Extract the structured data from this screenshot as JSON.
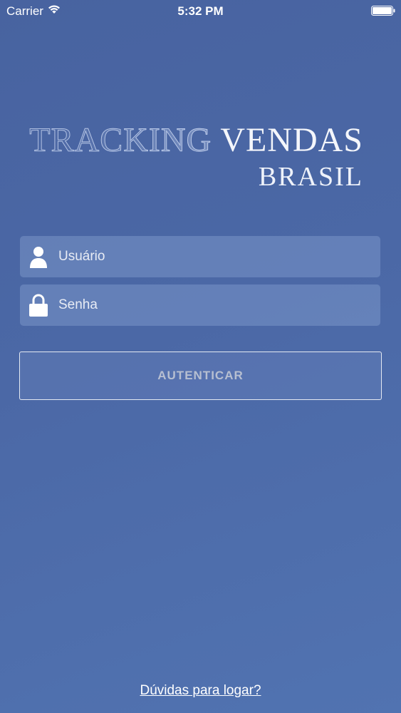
{
  "status_bar": {
    "carrier": "Carrier",
    "time": "5:32 PM",
    "wifi_icon": "wifi-icon",
    "battery_icon": "battery-icon"
  },
  "logo": {
    "line1_part_a": "TRACKING",
    "line1_part_b": " VENDAS",
    "line2": "BRASIL"
  },
  "form": {
    "username": {
      "placeholder": "Usuário",
      "value": "",
      "icon": "user-icon"
    },
    "password": {
      "placeholder": "Senha",
      "value": "",
      "icon": "lock-icon"
    },
    "submit_label": "AUTENTICAR"
  },
  "help": {
    "link_text": "Dúvidas para logar?"
  },
  "colors": {
    "background": "#4b68a6",
    "text": "#ffffff",
    "button_text": "#c8cdd7"
  }
}
